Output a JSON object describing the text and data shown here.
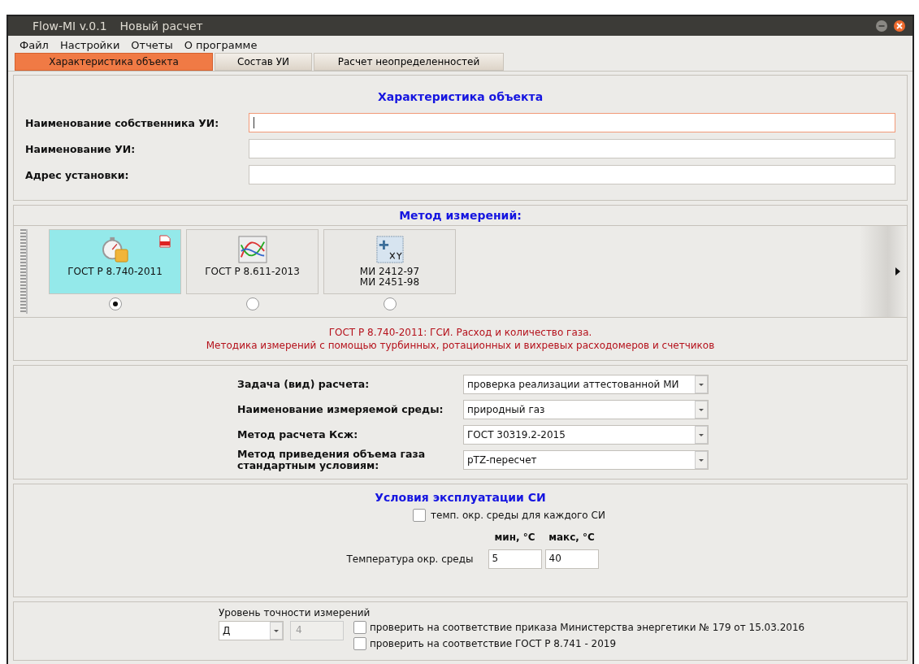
{
  "window": {
    "app_name": "Flow-MI v.0.1",
    "document": "Новый расчет"
  },
  "menu": [
    "Файл",
    "Настройки",
    "Отчеты",
    "О программе"
  ],
  "tabs": [
    {
      "label": "Характеристика объекта",
      "selected": true
    },
    {
      "label": "Состав УИ",
      "selected": false
    },
    {
      "label": "Расчет неопределенностей",
      "selected": false
    }
  ],
  "object": {
    "title": "Характеристика объекта",
    "fields": [
      {
        "label": "Наименование собственника УИ:",
        "focused": true
      },
      {
        "label": "Наименование УИ:",
        "focused": false
      },
      {
        "label": "Адрес установки:",
        "focused": false
      }
    ]
  },
  "method": {
    "title": "Метод измерений:",
    "options": [
      {
        "kind": "stopwatch",
        "lines": [
          "ГОСТ Р 8.740-2011"
        ],
        "pdf": true,
        "selected": true
      },
      {
        "kind": "curves",
        "lines": [
          "ГОСТ Р 8.611-2013"
        ],
        "pdf": false,
        "selected": false
      },
      {
        "kind": "formula",
        "lines": [
          "МИ 2412-97",
          "МИ 2451-98"
        ],
        "pdf": false,
        "selected": false
      }
    ],
    "description": [
      "ГОСТ Р 8.740-2011: ГСИ. Расход и количество газа.",
      "Методика измерений с помощью турбинных, ротационных и вихревых расходомеров и счетчиков"
    ]
  },
  "params": [
    {
      "lines": [
        "Задача (вид) расчета:"
      ],
      "value": "проверка реализации аттестованной МИ"
    },
    {
      "lines": [
        "Наименование измеряемой среды:"
      ],
      "value": "природный газ"
    },
    {
      "lines": [
        "Метод расчета Ксж:"
      ],
      "value": "ГОСТ 30319.2-2015"
    },
    {
      "lines": [
        "Метод приведения объема газа",
        "стандартным условиям:"
      ],
      "value": "pTZ-пересчет"
    }
  ],
  "conditions": {
    "title": "Условия эксплуатации СИ",
    "option": {
      "label": "темп. окр. среды для каждого СИ",
      "checked": false
    },
    "columns": [
      "мин, °C",
      "макс, °C"
    ],
    "row": {
      "label": "Температура окр. среды",
      "values": [
        "5",
        "40"
      ]
    }
  },
  "accuracy": {
    "title": "Уровень точности измерений",
    "grade": "Д",
    "class_value": "4",
    "class_disabled": true,
    "checks": [
      {
        "label": "проверить на соответствие приказа Министерства энергетики № 179 от 15.03.2016",
        "checked": false
      },
      {
        "label": "проверить на соответствие ГОСТ Р 8.741 - 2019",
        "checked": false
      }
    ]
  }
}
